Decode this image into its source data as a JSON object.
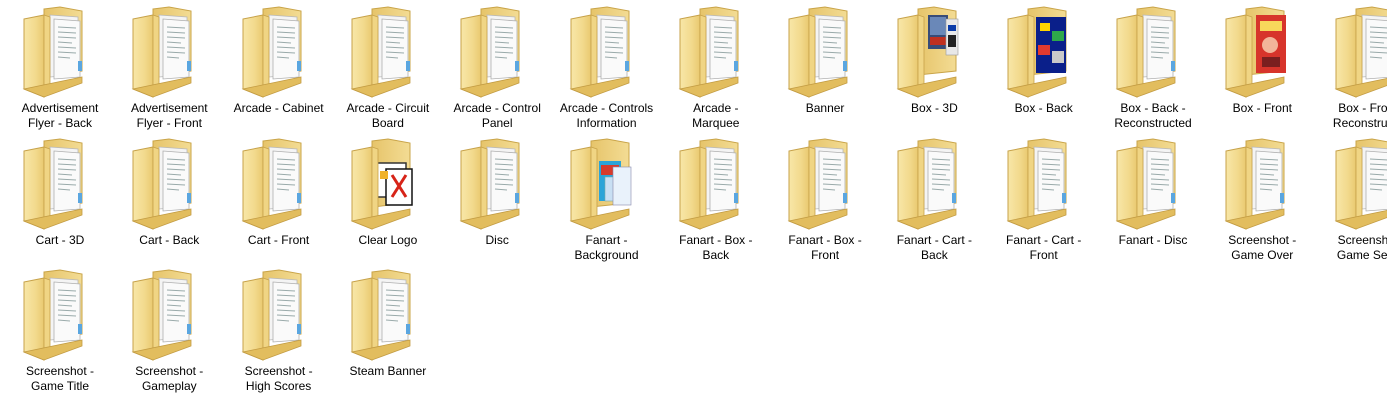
{
  "window": {
    "view": "Large icons",
    "folders": [
      {
        "label": "Advertisement\nFlyer - Back",
        "icon": "folder-icon"
      },
      {
        "label": "Advertisement\nFlyer - Front",
        "icon": "folder-icon"
      },
      {
        "label": "Arcade - Cabinet",
        "icon": "folder-icon"
      },
      {
        "label": "Arcade - Circuit\nBoard",
        "icon": "folder-icon"
      },
      {
        "label": "Arcade - Control\nPanel",
        "icon": "folder-icon"
      },
      {
        "label": "Arcade - Controls\nInformation",
        "icon": "folder-icon"
      },
      {
        "label": "Arcade -\nMarquee",
        "icon": "folder-icon"
      },
      {
        "label": "Banner",
        "icon": "folder-icon"
      },
      {
        "label": "Box - 3D",
        "icon": "folder-with-image-icon",
        "preview": "box3d"
      },
      {
        "label": "Box - Back",
        "icon": "folder-with-image-icon",
        "preview": "boxback"
      },
      {
        "label": "Box - Back -\nReconstructed",
        "icon": "folder-icon"
      },
      {
        "label": "Box - Front",
        "icon": "folder-with-image-icon",
        "preview": "boxfront"
      },
      {
        "label": "Box - Front -\nReconstructed",
        "icon": "folder-icon"
      },
      {
        "label": "Cart - 3D",
        "icon": "folder-icon"
      },
      {
        "label": "Cart - Back",
        "icon": "folder-icon"
      },
      {
        "label": "Cart - Front",
        "icon": "folder-icon"
      },
      {
        "label": "Clear Logo",
        "icon": "folder-with-image-icon",
        "preview": "logo"
      },
      {
        "label": "Disc",
        "icon": "folder-icon"
      },
      {
        "label": "Fanart -\nBackground",
        "icon": "folder-with-image-icon",
        "preview": "fanart"
      },
      {
        "label": "Fanart - Box -\nBack",
        "icon": "folder-icon"
      },
      {
        "label": "Fanart - Box -\nFront",
        "icon": "folder-icon"
      },
      {
        "label": "Fanart - Cart -\nBack",
        "icon": "folder-icon"
      },
      {
        "label": "Fanart - Cart -\nFront",
        "icon": "folder-icon"
      },
      {
        "label": "Fanart - Disc",
        "icon": "folder-icon"
      },
      {
        "label": "Screenshot -\nGame Over",
        "icon": "folder-icon"
      },
      {
        "label": "Screenshot -\nGame Select",
        "icon": "folder-icon"
      },
      {
        "label": "Screenshot -\nGame Title",
        "icon": "folder-icon"
      },
      {
        "label": "Screenshot -\nGameplay",
        "icon": "folder-icon"
      },
      {
        "label": "Screenshot -\nHigh Scores",
        "icon": "folder-icon"
      },
      {
        "label": "Steam Banner",
        "icon": "folder-icon"
      }
    ]
  }
}
